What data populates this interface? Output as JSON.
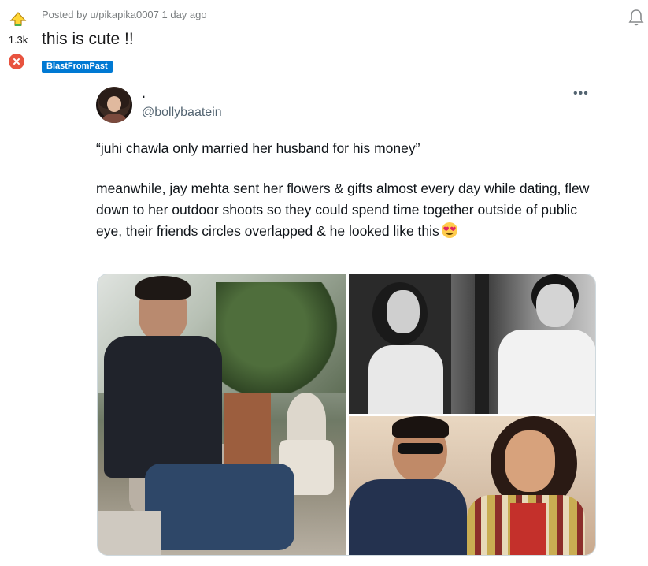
{
  "post": {
    "score": "1.3k",
    "meta": "Posted by u/pikapika0007 1 day ago",
    "title": "this is cute !!",
    "flair": "BlastFromPast"
  },
  "tweet": {
    "display_name": ".",
    "handle": "@bollybaatein",
    "more": "•••",
    "quote": "“juhi chawla only married her husband for his money”",
    "body": "meanwhile, jay mehta sent her flowers & gifts almost every day while dating, flew down to her outdoor shoots so they could spend time together outside of public eye, their friends circles overlapped & he looked like this",
    "emoji": "heart-eyes-emoji"
  },
  "colors": {
    "reddit_flair": "#0079d3",
    "downvote": "#e8533f",
    "upvote": "#ffd635"
  }
}
